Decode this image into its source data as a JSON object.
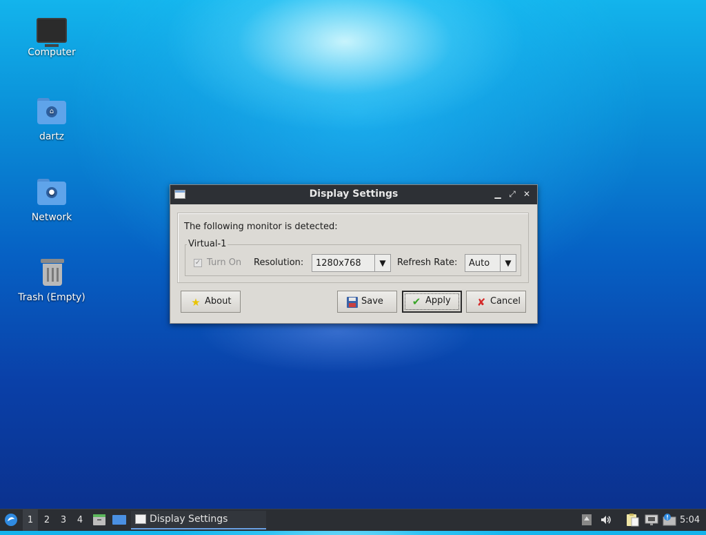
{
  "desktop": {
    "icons": [
      {
        "label": "Computer",
        "icon": "computer-icon"
      },
      {
        "label": "dartz",
        "icon": "home-folder-icon"
      },
      {
        "label": "Network",
        "icon": "network-folder-icon"
      },
      {
        "label": "Trash (Empty)",
        "icon": "trash-icon"
      }
    ]
  },
  "dialog": {
    "title": "Display Settings",
    "controls": {
      "minimize": "▁",
      "maximize": "⤢",
      "close": "✕"
    },
    "detected_text": "The following monitor is detected:",
    "monitor": {
      "name": "Virtual-1",
      "turn_on_label": "Turn On",
      "turn_on_checked": true,
      "resolution_label": "Resolution:",
      "resolution_value": "1280x768",
      "refresh_label": "Refresh Rate:",
      "refresh_value": "Auto"
    },
    "buttons": {
      "about": "About",
      "save": "Save",
      "apply": "Apply",
      "cancel": "Cancel"
    }
  },
  "taskbar": {
    "workspaces": [
      "1",
      "2",
      "3",
      "4"
    ],
    "active_workspace": "1",
    "task_label": "Display Settings",
    "clock": "5:04"
  },
  "colors": {
    "taskbar_bg": "#2b2e33",
    "titlebar_bg": "#2d3035",
    "dialog_bg": "#dcdad5"
  }
}
